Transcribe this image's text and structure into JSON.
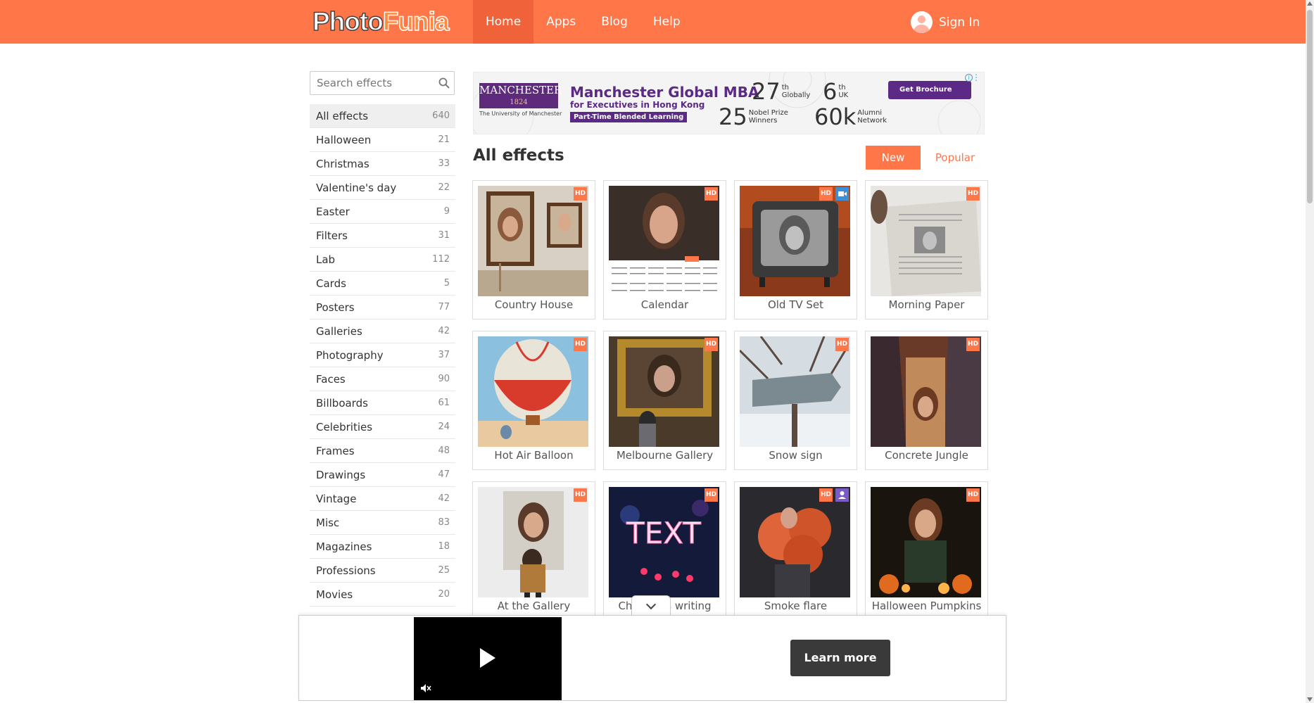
{
  "header": {
    "logo_part1": "Photo",
    "logo_part2": "Funia",
    "nav": [
      {
        "label": "Home",
        "active": true
      },
      {
        "label": "Apps"
      },
      {
        "label": "Blog"
      },
      {
        "label": "Help"
      }
    ],
    "signin_label": "Sign In"
  },
  "search": {
    "placeholder": "Search effects",
    "icon": "search-icon"
  },
  "categories": [
    {
      "label": "All effects",
      "count": "640",
      "active": true
    },
    {
      "label": "Halloween",
      "count": "21"
    },
    {
      "label": "Christmas",
      "count": "33"
    },
    {
      "label": "Valentine's day",
      "count": "22"
    },
    {
      "label": "Easter",
      "count": "9"
    },
    {
      "label": "Filters",
      "count": "31"
    },
    {
      "label": "Lab",
      "count": "112"
    },
    {
      "label": "Cards",
      "count": "5"
    },
    {
      "label": "Posters",
      "count": "77"
    },
    {
      "label": "Galleries",
      "count": "42"
    },
    {
      "label": "Photography",
      "count": "37"
    },
    {
      "label": "Faces",
      "count": "90"
    },
    {
      "label": "Billboards",
      "count": "61"
    },
    {
      "label": "Celebrities",
      "count": "24"
    },
    {
      "label": "Frames",
      "count": "48"
    },
    {
      "label": "Drawings",
      "count": "47"
    },
    {
      "label": "Vintage",
      "count": "42"
    },
    {
      "label": "Misc",
      "count": "83"
    },
    {
      "label": "Magazines",
      "count": "18"
    },
    {
      "label": "Professions",
      "count": "25"
    },
    {
      "label": "Movies",
      "count": "20"
    }
  ],
  "ad": {
    "logo_name": "MANCHESTER",
    "logo_year": "1824",
    "logo_sub": "The University of Manchester",
    "title": "Manchester Global MBA",
    "subtitle": "for Executives in Hong Kong",
    "tag": "Part-Time Blended Learning",
    "stats": [
      {
        "big": "27",
        "sup": "th",
        "label": "Globally"
      },
      {
        "big": "6",
        "sup": "th",
        "label": "UK"
      },
      {
        "big": "25",
        "sup": "",
        "label": "Nobel Prize Winners"
      },
      {
        "big": "60k",
        "sup": "",
        "label": "Alumni Network"
      }
    ],
    "cta": "Get Brochure"
  },
  "main": {
    "title": "All effects",
    "sort_new": "New",
    "sort_popular": "Popular"
  },
  "effects": [
    {
      "label": "Country House",
      "badges": [
        "HD"
      ]
    },
    {
      "label": "Calendar",
      "badges": [
        "HD"
      ]
    },
    {
      "label": "Old TV Set",
      "badges": [
        "HD",
        "video"
      ]
    },
    {
      "label": "Morning Paper",
      "badges": [
        "HD"
      ]
    },
    {
      "label": "Hot Air Balloon",
      "badges": [
        "HD"
      ]
    },
    {
      "label": "Melbourne Gallery",
      "badges": [
        "HD"
      ]
    },
    {
      "label": "Snow sign",
      "badges": [
        "HD"
      ]
    },
    {
      "label": "Concrete Jungle",
      "badges": [
        "HD"
      ]
    },
    {
      "label": "At the Gallery",
      "badges": [
        "HD"
      ]
    },
    {
      "label": "Christmas writing",
      "badges": [
        "HD"
      ]
    },
    {
      "label": "Smoke flare",
      "badges": [
        "HD",
        "person"
      ]
    },
    {
      "label": "Halloween Pumpkins",
      "badges": [
        "HD"
      ]
    }
  ],
  "badge_hd": "HD",
  "video_ad": {
    "learn_more": "Learn more"
  },
  "colors": {
    "brand": "#ff7649",
    "ad_purple": "#5b2a86"
  }
}
